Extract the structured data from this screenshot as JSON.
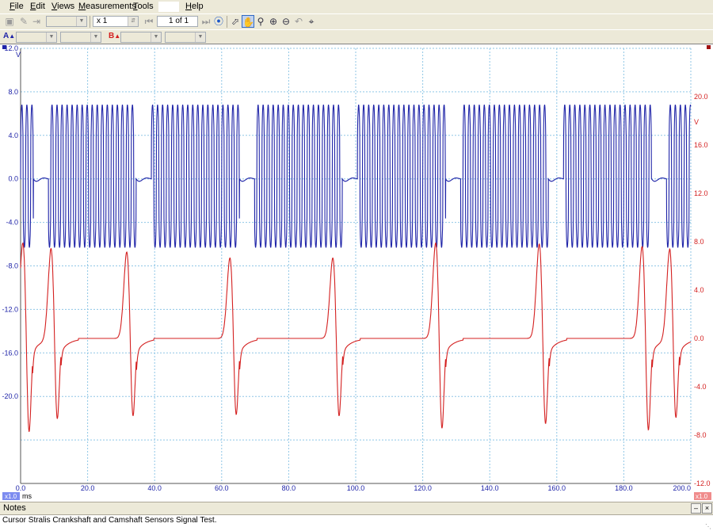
{
  "menu": {
    "items": [
      {
        "label": "File",
        "access": "F",
        "rest": "ile"
      },
      {
        "label": "Edit",
        "access": "E",
        "rest": "dit"
      },
      {
        "label": "Views",
        "access": "V",
        "rest": "iews"
      },
      {
        "label": "Measurements",
        "access": "M",
        "rest": "easurements"
      },
      {
        "label": "Tools",
        "access": "T",
        "rest": "ools"
      },
      {
        "label": "Help",
        "access": "H",
        "rest": "elp"
      }
    ]
  },
  "toolbar": {
    "zoom_value": "x 1",
    "page_indicator": "1 of 1"
  },
  "channels": {
    "a_label": "A",
    "b_label": "B",
    "a_color": "#1f24a8",
    "b_color": "#d42020"
  },
  "notes": {
    "title": "Notes",
    "text": "Cursor Stralis Crankshaft and Camshaft Sensors Signal Test."
  },
  "chart_data": {
    "type": "line",
    "x_unit": "ms",
    "x_range": [
      0,
      200
    ],
    "x_ticks": [
      "0.0",
      "20.0",
      "40.0",
      "60.0",
      "80.0",
      "100.0",
      "120.0",
      "140.0",
      "160.0",
      "180.0",
      "200.0"
    ],
    "x_scale_badge": "x1.0",
    "grid": true,
    "left_axis": {
      "unit": "V",
      "range": [
        -28,
        12
      ],
      "ticks": [
        "12.0",
        "8.0",
        "4.0",
        "0.0",
        "-4.0",
        "-8.0",
        "-12.0",
        "-16.0",
        "-20.0"
      ],
      "tick_values": [
        12,
        8,
        4,
        0,
        -4,
        -8,
        -12,
        -16,
        -20
      ]
    },
    "right_axis": {
      "unit": "V",
      "range": [
        -12,
        24
      ],
      "ticks": [
        "20.0",
        "16.0",
        "12.0",
        "8.0",
        "4.0",
        "0.0",
        "-4.0",
        "-8.0",
        "-12.0"
      ],
      "tick_values": [
        20,
        16,
        12,
        8,
        4,
        0,
        -4,
        -8,
        -12
      ],
      "scale_badge": "x1.0"
    },
    "series": [
      {
        "channel": "A",
        "axis": "left",
        "color": "#1f24a8",
        "amplitude_max": 6.8,
        "amplitude_min": -6.3,
        "tooth_period_ms": 1.5,
        "gap_starts_ms": [
          3.8,
          34.5,
          65.3,
          96.0,
          126.8,
          157.5,
          188.3
        ],
        "gap_length_ms": 4.5
      },
      {
        "channel": "B",
        "axis": "right",
        "color": "#d42020",
        "baseline": 0.0,
        "pulses": [
          {
            "x": 0.8,
            "peak": 8.3,
            "trough": -9.5
          },
          {
            "x": 9.2,
            "peak": 7.8,
            "trough": -8.3
          },
          {
            "x": 31.8,
            "peak": 7.5,
            "trough": -8.0
          },
          {
            "x": 62.6,
            "peak": 7.0,
            "trough": -7.8
          },
          {
            "x": 93.3,
            "peak": 7.0,
            "trough": -7.9
          },
          {
            "x": 124.0,
            "peak": 8.3,
            "trough": -9.2
          },
          {
            "x": 154.9,
            "peak": 8.2,
            "trough": -8.8
          },
          {
            "x": 185.6,
            "peak": 8.0,
            "trough": -9.3
          },
          {
            "x": 193.8,
            "peak": 7.8,
            "trough": -8.2
          }
        ]
      }
    ]
  }
}
